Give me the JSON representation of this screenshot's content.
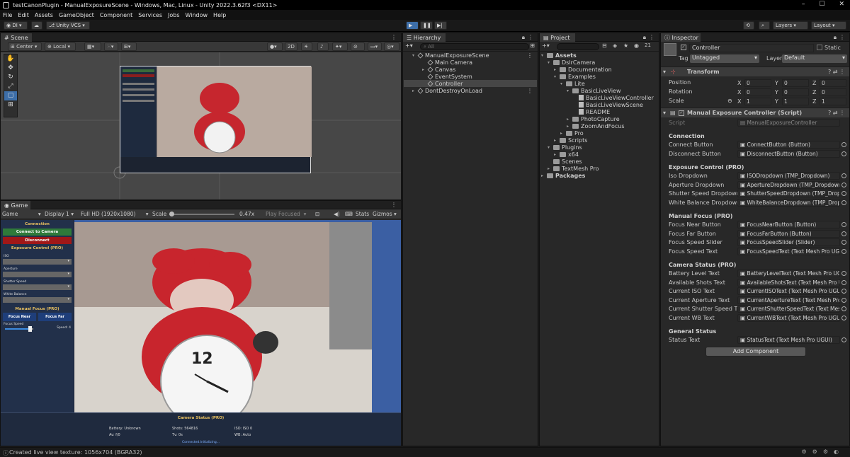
{
  "window": {
    "title": "testCanonPlugin - ManualExposureScene - Windows, Mac, Linux - Unity 2022.3.62f3 <DX11>"
  },
  "menu": [
    "File",
    "Edit",
    "Assets",
    "GameObject",
    "Component",
    "Services",
    "Jobs",
    "Window",
    "Help"
  ],
  "toolbar": {
    "account": "DI",
    "vcs": "Unity VCS",
    "layers": "Layers",
    "layout": "Layout"
  },
  "scene": {
    "tab": "Scene",
    "pivot": "Center",
    "space": "Local",
    "mode2d": "2D"
  },
  "game": {
    "tab": "Game",
    "view": "Game",
    "display": "Display 1",
    "resolution": "Full HD (1920x1080)",
    "scale_label": "Scale",
    "scale_value": "0.47x",
    "play_mode": "Play Focused",
    "stats": "Stats",
    "gizmos": "Gizmos",
    "ui": {
      "connection": "Connection",
      "connect": "Connect to Camera",
      "disconnect": "Disconnect",
      "exposure": "Exposure Control (PRO)",
      "iso": "ISO",
      "aperture": "Aperture",
      "shutter": "Shutter Speed",
      "wb": "White Balance",
      "manual_focus": "Manual Focus (PRO)",
      "focus_near": "Focus Near",
      "focus_far": "Focus Far",
      "focus_speed": "Focus Speed",
      "speed": "Speed: 4",
      "slider_level": 0.9,
      "camera_status": "Camera Status (PRO)",
      "battery": "Battery: Unknown",
      "shots": "Shots: 564816",
      "iso_val": "ISO: ISO 0",
      "av": "Av: f/0",
      "tv": "Tv: 0s",
      "wb_val": "WB: Auto",
      "status": "Connected.Initializing..."
    }
  },
  "hierarchy": {
    "tab": "Hierarchy",
    "search_placeholder": "All",
    "items": [
      {
        "label": "ManualExposureScene",
        "type": "scene"
      },
      {
        "label": "Main Camera",
        "type": "obj"
      },
      {
        "label": "Canvas",
        "type": "obj"
      },
      {
        "label": "EventSystem",
        "type": "obj"
      },
      {
        "label": "Controller",
        "type": "obj"
      },
      {
        "label": "DontDestroyOnLoad",
        "type": "scene"
      }
    ]
  },
  "project": {
    "tab": "Project",
    "count": "21",
    "items": [
      "Assets",
      "DslrCamera",
      "Documentation",
      "Examples",
      "Lite",
      "BasicLiveView",
      "BasicLiveViewController",
      "BasicLiveViewScene",
      "README",
      "PhotoCapture",
      "ZoomAndFocus",
      "Pro",
      "Scripts",
      "Plugins",
      "x64",
      "Scenes",
      "TextMesh Pro",
      "Packages"
    ]
  },
  "inspector": {
    "tab": "Inspector",
    "name": "Controller",
    "static": "Static",
    "tag_label": "Tag",
    "tag": "Untagged",
    "layer_label": "Layer",
    "layer": "Default",
    "transform": {
      "title": "Transform",
      "position": "Position",
      "rotation": "Rotation",
      "scale": "Scale",
      "pos": [
        "0",
        "0",
        "0"
      ],
      "rot": [
        "0",
        "0",
        "0"
      ],
      "scl": [
        "1",
        "1",
        "1"
      ]
    },
    "script_title": "Manual Exposure Controller (Script)",
    "script_label": "Script",
    "script_value": "ManualExposureController",
    "sections": [
      {
        "header": "Connection",
        "rows": [
          [
            "Connect Button",
            "ConnectButton (Button)"
          ],
          [
            "Disconnect Button",
            "DisconnectButton (Button)"
          ]
        ]
      },
      {
        "header": "Exposure Control (PRO)",
        "rows": [
          [
            "Iso Dropdown",
            "ISODropdown (TMP_Dropdown)"
          ],
          [
            "Aperture Dropdown",
            "ApertureDropdown (TMP_Dropdown)"
          ],
          [
            "Shutter Speed Dropdown",
            "ShutterSpeedDropdown (TMP_Dropdo"
          ],
          [
            "White Balance Dropdown",
            "WhiteBalanceDropdown (TMP_Dropdo"
          ]
        ]
      },
      {
        "header": "Manual Focus (PRO)",
        "rows": [
          [
            "Focus Near Button",
            "FocusNearButton (Button)"
          ],
          [
            "Focus Far Button",
            "FocusFarButton (Button)"
          ],
          [
            "Focus Speed Slider",
            "FocusSpeedSlider (Slider)"
          ],
          [
            "Focus Speed Text",
            "FocusSpeedText (Text Mesh Pro UGUI)"
          ]
        ]
      },
      {
        "header": "Camera Status (PRO)",
        "rows": [
          [
            "Battery Level Text",
            "BatteryLevelText (Text Mesh Pro UGU"
          ],
          [
            "Available Shots Text",
            "AvailableShotsText (Text Mesh Pro U"
          ],
          [
            "Current ISO Text",
            "CurrentISOText (Text Mesh Pro UGUI)"
          ],
          [
            "Current Aperture Text",
            "CurrentApertureText (Text Mesh Pro"
          ],
          [
            "Current Shutter Speed T...",
            "CurrentShutterSpeedText (Text Mesh"
          ],
          [
            "Current WB Text",
            "CurrentWBText (Text Mesh Pro UGUI)"
          ]
        ]
      },
      {
        "header": "General Status",
        "rows": [
          [
            "Status Text",
            "StatusText (Text Mesh Pro UGUI)"
          ]
        ]
      }
    ],
    "add_component": "Add Component"
  },
  "statusbar": "Created live view texture: 1056x704 (BGRA32)"
}
